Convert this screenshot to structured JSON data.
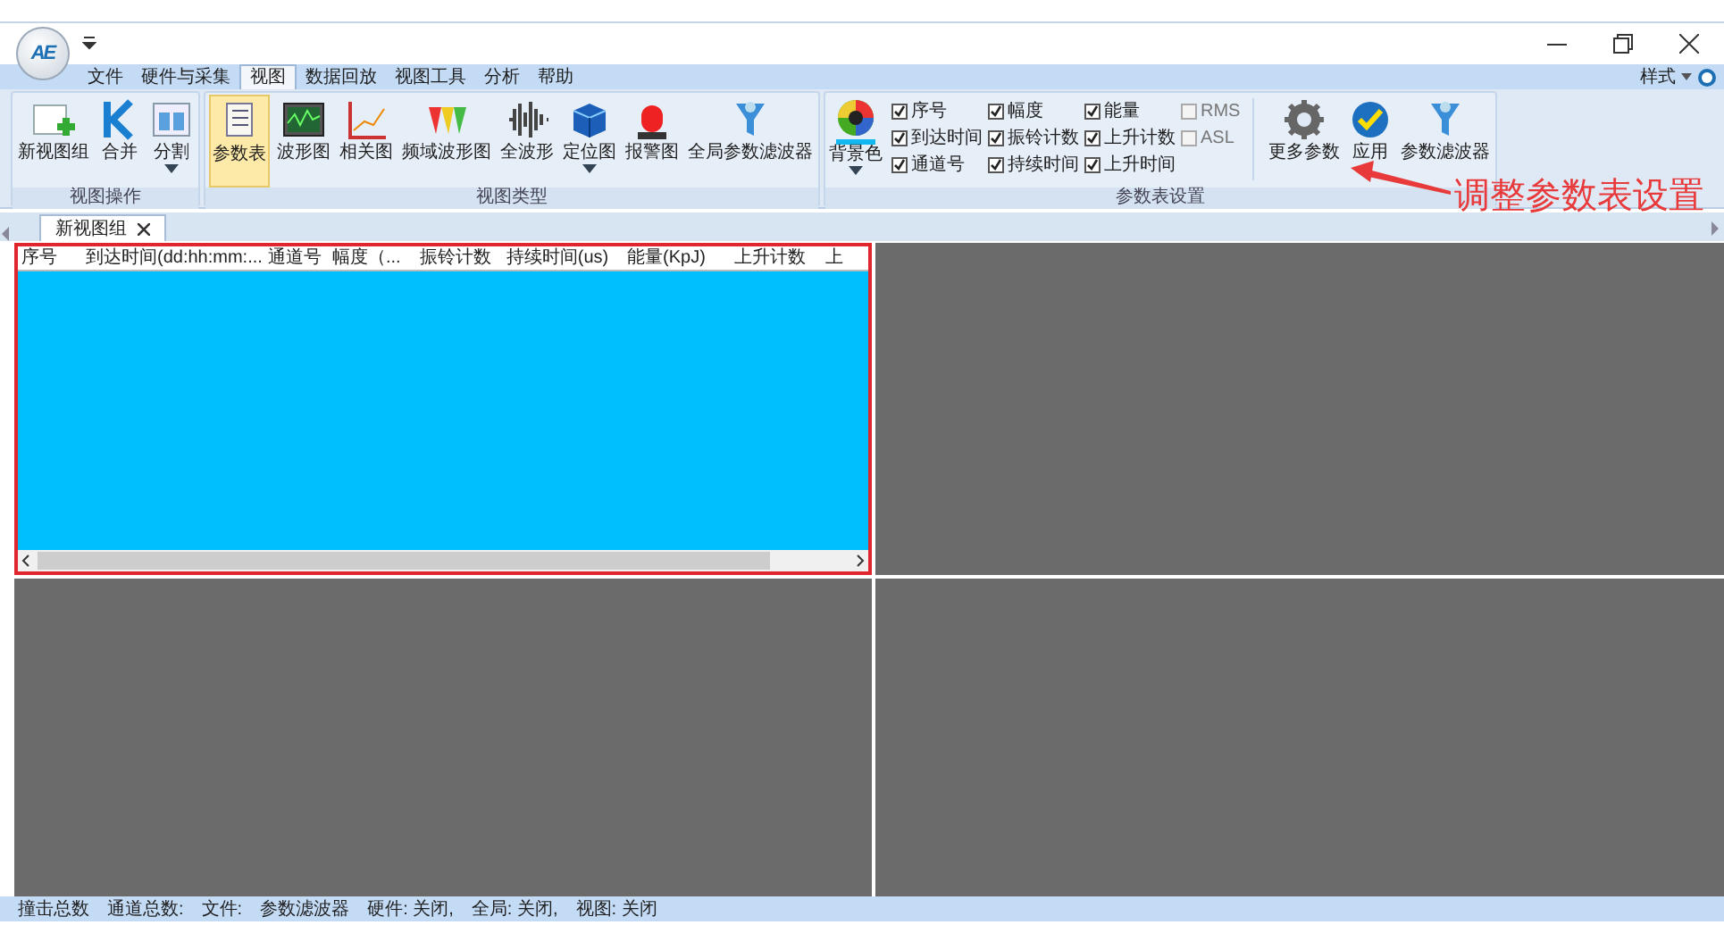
{
  "app": {
    "logo": "AE"
  },
  "menu_tabs": [
    {
      "label": "文件",
      "selected": false
    },
    {
      "label": "硬件与采集",
      "selected": false
    },
    {
      "label": "视图",
      "selected": true
    },
    {
      "label": "数据回放",
      "selected": false
    },
    {
      "label": "视图工具",
      "selected": false
    },
    {
      "label": "分析",
      "selected": false
    },
    {
      "label": "帮助",
      "selected": false
    }
  ],
  "style_menu": "样式",
  "ribbon_groups": [
    {
      "title": "视图操作",
      "kind": "buttons",
      "items": [
        {
          "label": "新视图组",
          "selected": false,
          "dropdown": false
        },
        {
          "label": "合并",
          "selected": false,
          "dropdown": false
        },
        {
          "label": "分割",
          "selected": false,
          "dropdown": true
        }
      ]
    },
    {
      "title": "视图类型",
      "kind": "buttons",
      "items": [
        {
          "label": "参数表",
          "selected": true,
          "dropdown": false
        },
        {
          "label": "波形图",
          "selected": false,
          "dropdown": false
        },
        {
          "label": "相关图",
          "selected": false,
          "dropdown": false
        },
        {
          "label": "频域波形图",
          "selected": false,
          "dropdown": false
        },
        {
          "label": "全波形",
          "selected": false,
          "dropdown": false
        },
        {
          "label": "定位图",
          "selected": false,
          "dropdown": true
        },
        {
          "label": "报警图",
          "selected": false,
          "dropdown": false
        },
        {
          "label": "全局参数滤波器",
          "selected": false,
          "dropdown": false
        }
      ]
    },
    {
      "title": "参数表设置",
      "kind": "settings",
      "color_button": {
        "label": "背景色",
        "dropdown": true
      },
      "checkbox_columns": [
        [
          {
            "label": "序号",
            "checked": true
          },
          {
            "label": "到达时间",
            "checked": true
          },
          {
            "label": "通道号",
            "checked": true
          }
        ],
        [
          {
            "label": "幅度",
            "checked": true
          },
          {
            "label": "振铃计数",
            "checked": true
          },
          {
            "label": "持续时间",
            "checked": true
          }
        ],
        [
          {
            "label": "能量",
            "checked": true
          },
          {
            "label": "上升计数",
            "checked": true
          },
          {
            "label": "上升时间",
            "checked": true
          }
        ],
        [
          {
            "label": "RMS",
            "checked": false
          },
          {
            "label": "ASL",
            "checked": false
          }
        ]
      ],
      "items": [
        {
          "label": "更多参数",
          "selected": false,
          "dropdown": false
        },
        {
          "label": "应用",
          "selected": false,
          "dropdown": false
        },
        {
          "label": "参数滤波器",
          "selected": false,
          "dropdown": false
        }
      ]
    }
  ],
  "annotation": {
    "text": "调整参数表设置"
  },
  "doc_tabs": [
    {
      "label": "新视图组",
      "selected": true
    }
  ],
  "panels": [
    {
      "kind": "table",
      "selected": true,
      "columns": [
        "序号",
        "到达时间(dd:hh:mm:...",
        "通道号",
        "幅度（...",
        "振铃计数",
        "持续时间(us)",
        "能量(KpJ)",
        "上升计数",
        "上"
      ]
    },
    {
      "kind": "empty",
      "selected": false
    },
    {
      "kind": "empty",
      "selected": false
    },
    {
      "kind": "empty",
      "selected": false
    }
  ],
  "status_bar": [
    "撞击总数",
    "通道总数:",
    "文件:",
    "参数滤波器",
    "硬件: 关闭,",
    "全局: 关闭,",
    "视图: 关闭"
  ]
}
